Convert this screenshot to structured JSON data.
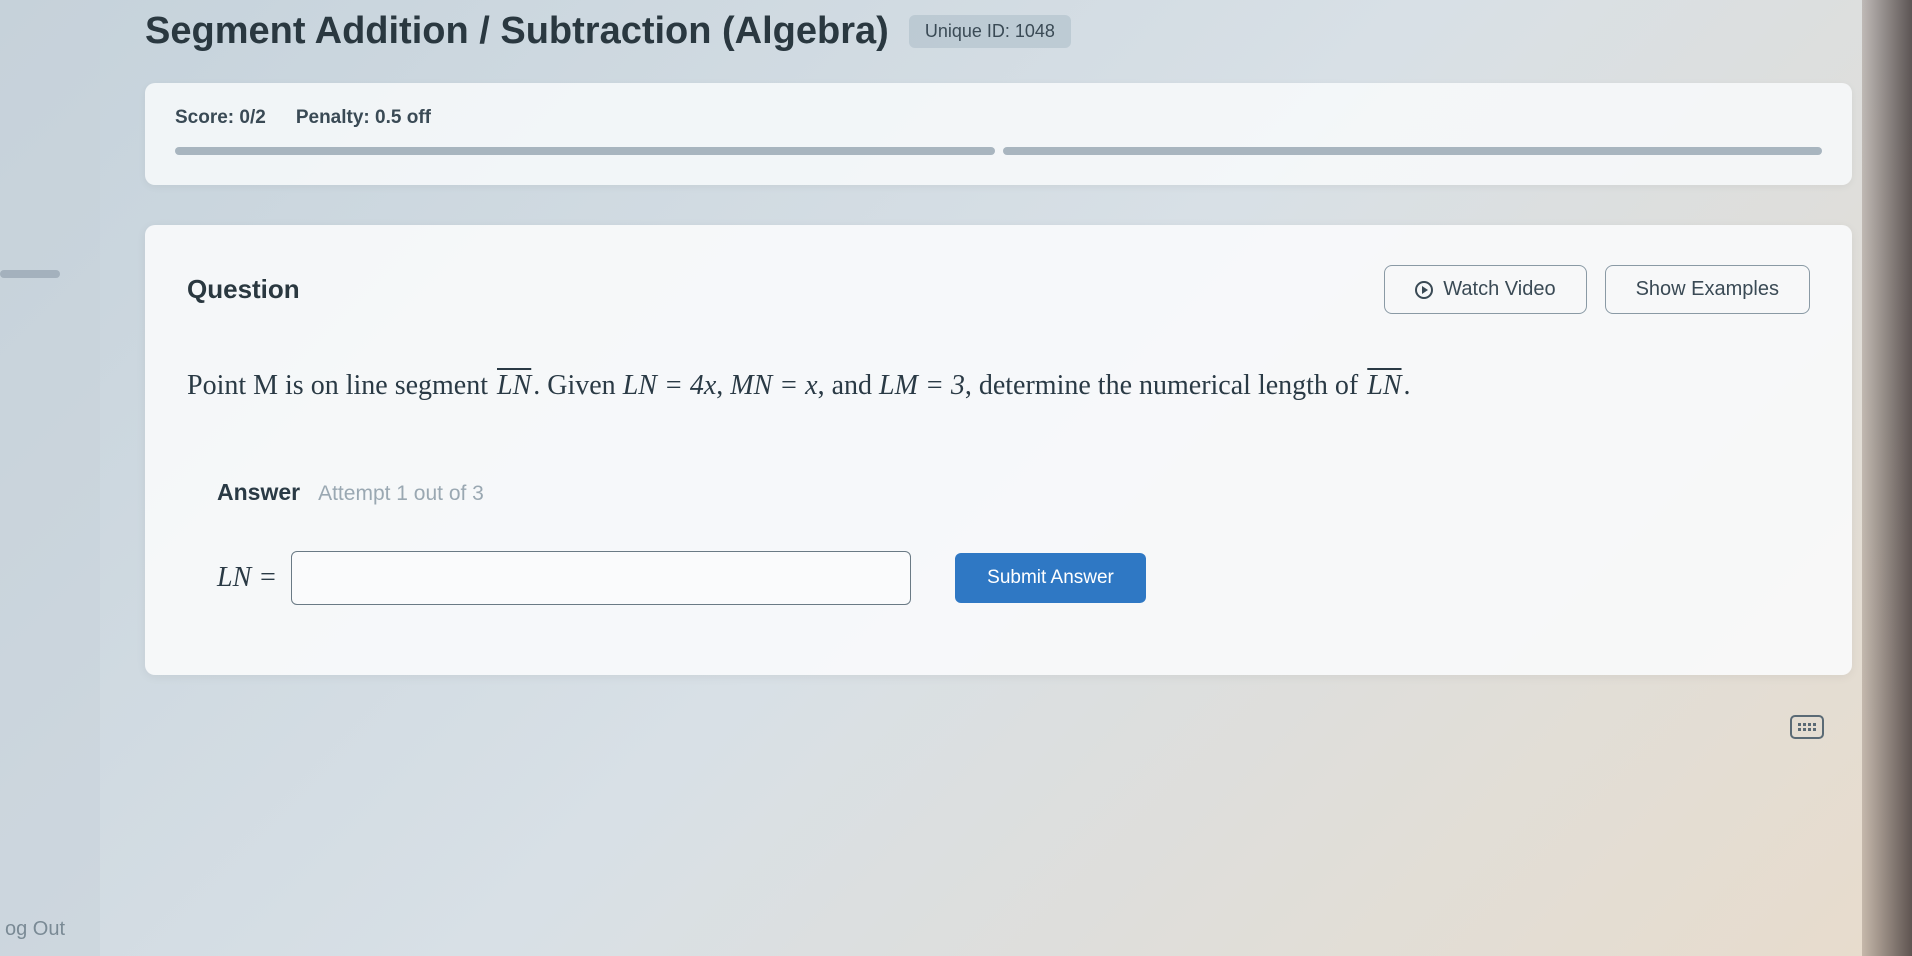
{
  "header": {
    "title": "Segment Addition / Subtraction (Algebra)",
    "unique_id_label": "Unique ID: 1048"
  },
  "score_card": {
    "score": "Score: 0/2",
    "penalty": "Penalty: 0.5 off"
  },
  "question": {
    "heading": "Question",
    "watch_video_label": "Watch Video",
    "show_examples_label": "Show Examples",
    "text_part1": "Point M is on line segment ",
    "segment1": "LN",
    "text_part2": ". Given ",
    "eq1_lhs": "LN",
    "eq1_rhs": " = 4x",
    "text_part3": ", ",
    "eq2_lhs": "MN",
    "eq2_rhs": " = x",
    "text_part4": ", and ",
    "eq3_lhs": "LM",
    "eq3_rhs": " = 3",
    "text_part5": ", determine the numerical length of ",
    "segment2": "LN",
    "text_part6": "."
  },
  "answer": {
    "label": "Answer",
    "attempt": "Attempt 1 out of 3",
    "prefix": "LN =",
    "submit_label": "Submit Answer"
  },
  "sidebar": {
    "logout": "og Out"
  }
}
